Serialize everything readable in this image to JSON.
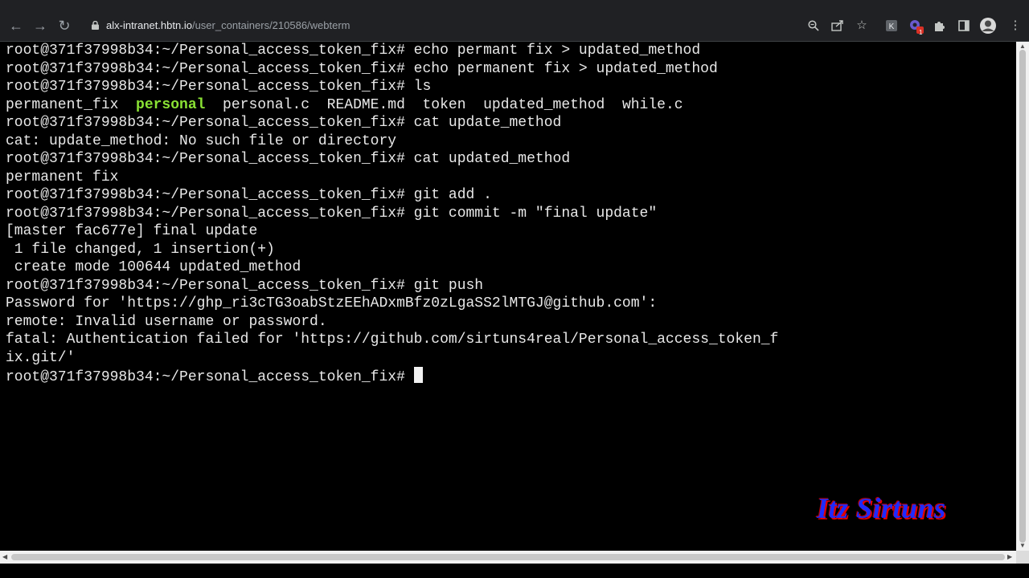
{
  "browser": {
    "url_host": "alx-intranet.hbtn.io",
    "url_path": "/user_containers/210586/webterm",
    "toolbar_icons": [
      "zoom-icon",
      "share-icon",
      "bookmark-star-icon",
      "extension-k-icon",
      "extension-badge-icon",
      "extensions-puzzle-icon",
      "side-panel-icon",
      "profile-avatar-icon"
    ],
    "extension_badge": "1"
  },
  "terminal": {
    "lines": [
      "root@371f37998b34:~/Personal_access_token_fix# echo permant fix > updated_method",
      "root@371f37998b34:~/Personal_access_token_fix# echo permanent fix > updated_method",
      "root@371f37998b34:~/Personal_access_token_fix# ls",
      "",
      "root@371f37998b34:~/Personal_access_token_fix# cat update_method",
      "cat: update_method: No such file or directory",
      "root@371f37998b34:~/Personal_access_token_fix# cat updated_method",
      "permanent fix",
      "root@371f37998b34:~/Personal_access_token_fix# git add .",
      "root@371f37998b34:~/Personal_access_token_fix# git commit -m \"final update\"",
      "[master fac677e] final update",
      " 1 file changed, 1 insertion(+)",
      " create mode 100644 updated_method",
      "root@371f37998b34:~/Personal_access_token_fix# git push",
      "Password for 'https://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@github.com':",
      "remote: Invalid username or password.",
      "fatal: Authentication failed for 'https://github.com/sirtuns4real/Personal_access_token_f",
      "ix.git/'"
    ],
    "ls_output": {
      "before": "permanent_fix  ",
      "highlighted": "personal",
      "after": "  personal.c  README.md  token  updated_method  while.c"
    },
    "prompt": "root@371f37998b34:~/Personal_access_token_fix# "
  },
  "watermark": "Itz Sirtuns"
}
